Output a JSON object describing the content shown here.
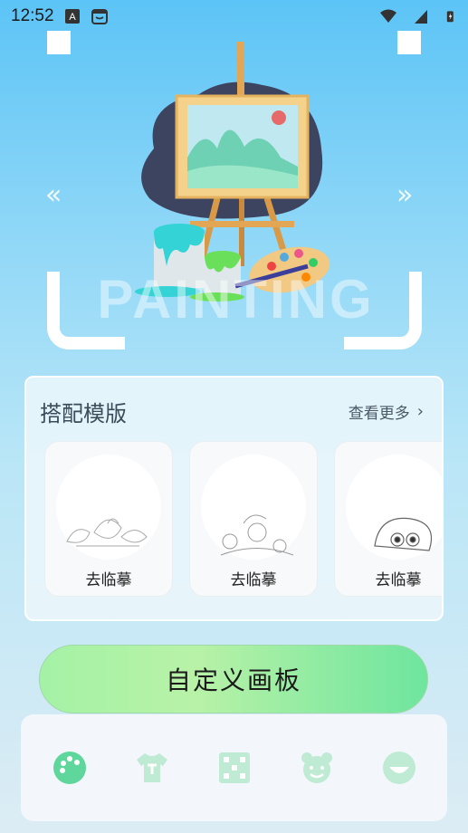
{
  "status_bar": {
    "time": "12:52",
    "icons": [
      "text-icon",
      "face-icon",
      "wifi-icon",
      "signal-icon",
      "battery-charging-icon"
    ]
  },
  "hero": {
    "watermark_text": "PAINTING",
    "prev_arrow": "«",
    "next_arrow": "»"
  },
  "templates": {
    "title": "搭配模版",
    "more_label": "查看更多",
    "more_chevron": "›",
    "items": [
      {
        "label": "去临摹",
        "sketch": "flowers"
      },
      {
        "label": "去临摹",
        "sketch": "flowers"
      },
      {
        "label": "去临摹",
        "sketch": "creature"
      }
    ]
  },
  "custom_board_button": "自定义画板",
  "tabbar": {
    "tabs": [
      {
        "icon": "palette-icon",
        "active": true
      },
      {
        "icon": "shirt-icon",
        "active": false
      },
      {
        "icon": "dice-icon",
        "active": false
      },
      {
        "icon": "bear-icon",
        "active": false
      },
      {
        "icon": "smile-icon",
        "active": false
      }
    ]
  },
  "colors": {
    "accent_green": "#5fd69b",
    "inactive_tab": "#bfead3"
  }
}
